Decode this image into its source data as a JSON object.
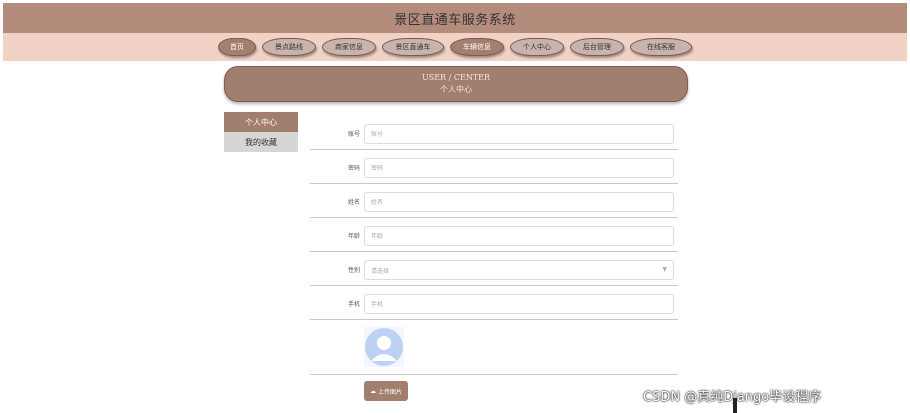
{
  "header": {
    "title": "景区直通车服务系统"
  },
  "nav": {
    "items": [
      {
        "label": "首页"
      },
      {
        "label": "景点路线"
      },
      {
        "label": "商家信息"
      },
      {
        "label": "景区直通车"
      },
      {
        "label": "车辆信息"
      },
      {
        "label": "个人中心"
      },
      {
        "label": "后台管理"
      },
      {
        "label": "在线客服"
      }
    ]
  },
  "banner": {
    "en": "USER / CENTER",
    "cn": "个人中心"
  },
  "sidemenu": {
    "items": [
      {
        "label": "个人中心"
      },
      {
        "label": "我的收藏"
      }
    ]
  },
  "form": {
    "account": {
      "label": "账号",
      "placeholder": "账号"
    },
    "password": {
      "label": "密码",
      "placeholder": "密码"
    },
    "name": {
      "label": "姓名",
      "placeholder": "姓名"
    },
    "age": {
      "label": "年龄",
      "placeholder": "年龄"
    },
    "gender": {
      "label": "性别",
      "placeholder": "请选择"
    },
    "phone": {
      "label": "手机",
      "placeholder": "手机"
    }
  },
  "upload": {
    "label": "上传图片"
  },
  "watermark": "CSDN @真纯Django毕设程序",
  "colors": {
    "primary": "#a27e6f",
    "nav_bg": "#f3d2c6",
    "header_bg": "#b38c7c"
  }
}
